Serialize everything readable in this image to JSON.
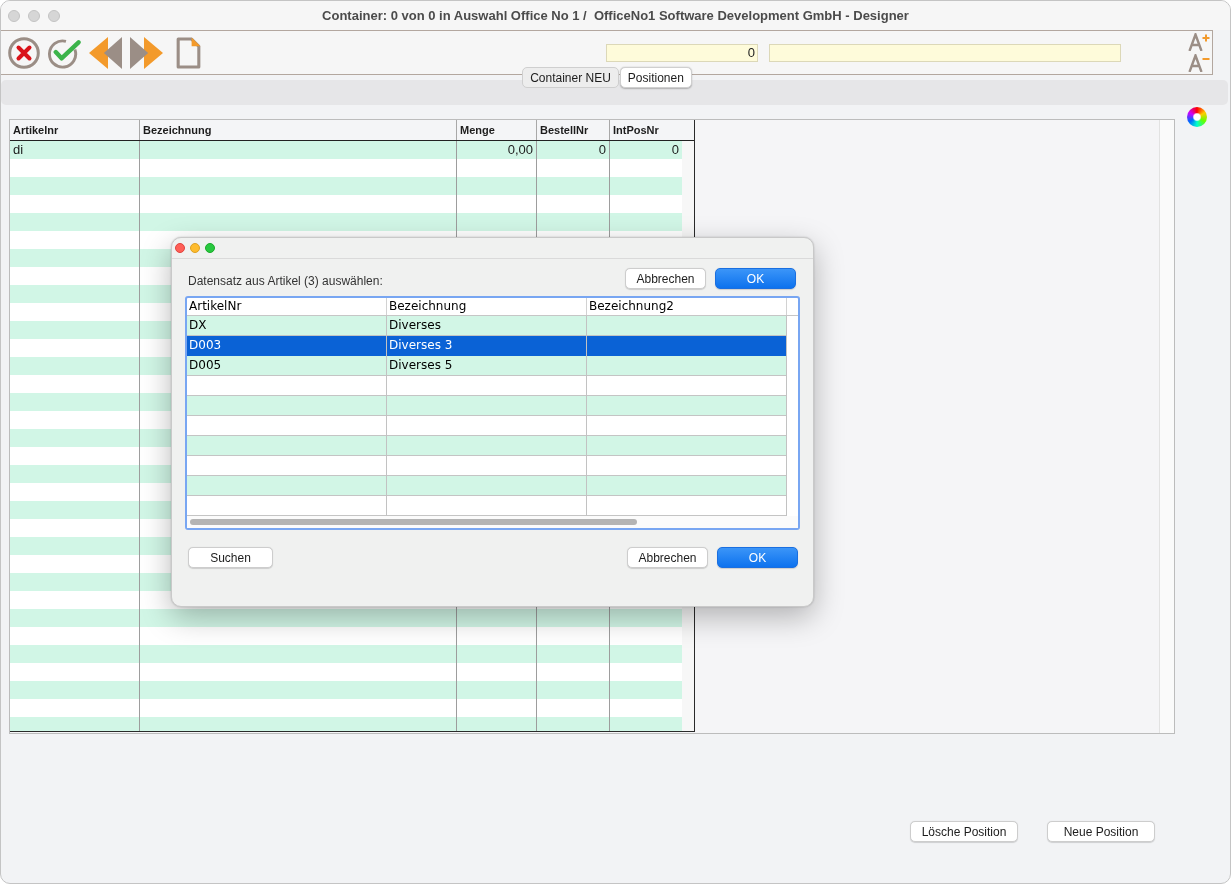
{
  "window": {
    "title": "Container: 0 von 0 in Auswahl Office No 1 /  OfficeNo1 Software Development GmbH - Designer",
    "active": false
  },
  "toolbar": {
    "buttons": [
      {
        "kind": "cancel"
      },
      {
        "kind": "confirm"
      },
      {
        "kind": "previous"
      },
      {
        "kind": "next"
      },
      {
        "kind": "new"
      }
    ],
    "counter_field": {
      "value": "0"
    },
    "zoom_buttons": [
      {
        "kind": "larger"
      },
      {
        "kind": "smaller"
      }
    ]
  },
  "tabs": [
    {
      "label": "Container NEU",
      "selected": false
    },
    {
      "label": "Positionen",
      "selected": true
    }
  ],
  "positions_table": {
    "columns": [
      {
        "label": "Artikelnr",
        "kind": "text"
      },
      {
        "label": "Bezeichnung",
        "kind": "text"
      },
      {
        "label": "Menge",
        "kind": "number"
      },
      {
        "label": "BestellNr",
        "kind": "number"
      },
      {
        "label": "IntPosNr",
        "kind": "number"
      }
    ],
    "rows": [
      [
        "di",
        null,
        "0,00",
        "0",
        "0"
      ]
    ]
  },
  "dialog": {
    "active": true,
    "prompt": "Datensatz aus Artikel (3) auswählen:",
    "top_buttons": [
      {
        "label": "Abbrechen",
        "kind": "secondary"
      },
      {
        "label": "OK",
        "kind": "primary"
      }
    ],
    "table": {
      "columns": [
        "ArtikelNr",
        "Bezeichnung",
        "Bezeichnung2"
      ],
      "rows": [
        {
          "cells": [
            "DX",
            "Diverses",
            null
          ],
          "selected": false
        },
        {
          "cells": [
            "D003",
            "Diverses 3",
            null
          ],
          "selected": true
        },
        {
          "cells": [
            "D005",
            "Diverses 5",
            null
          ],
          "selected": false
        }
      ]
    },
    "search_button": {
      "label": "Suchen"
    },
    "bottom_buttons": [
      {
        "label": "Abbrechen",
        "kind": "secondary"
      },
      {
        "label": "OK",
        "kind": "primary"
      }
    ]
  },
  "footer_buttons": [
    {
      "label": "Lösche Position"
    },
    {
      "label": "Neue Position"
    }
  ]
}
